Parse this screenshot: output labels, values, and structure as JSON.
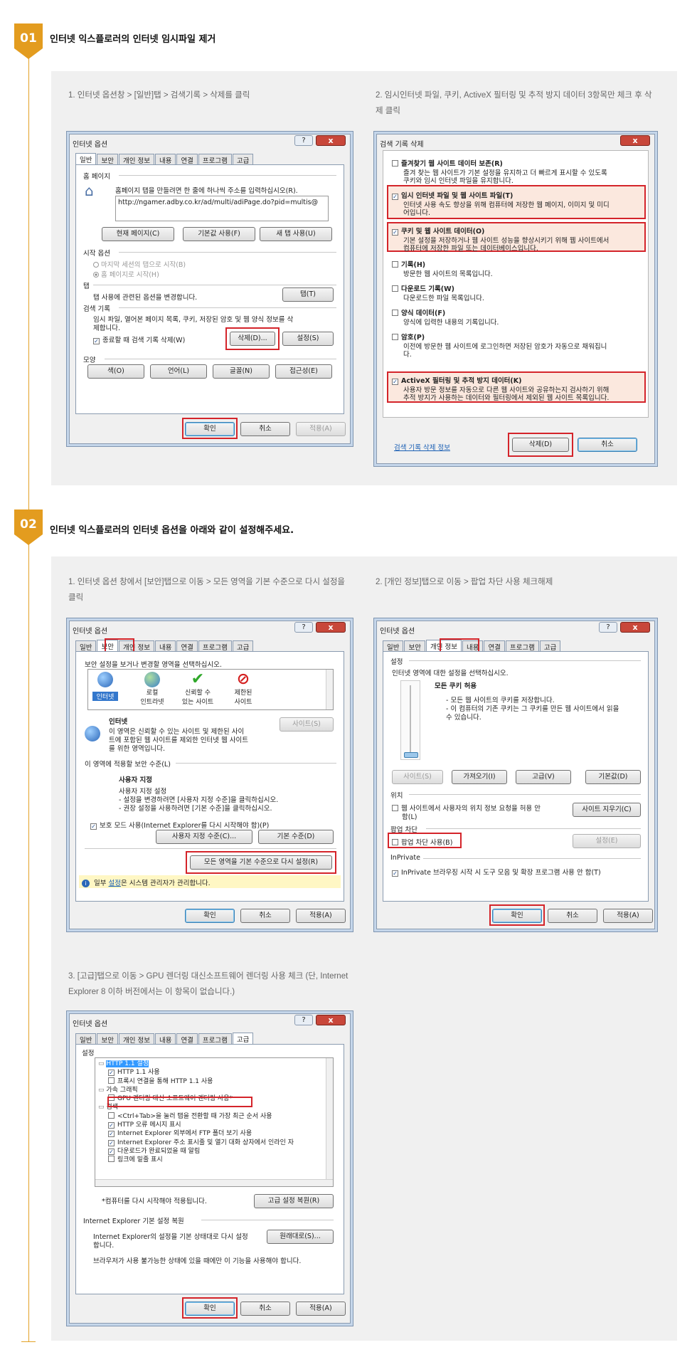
{
  "steps": [
    {
      "num": "01",
      "title": "인터넷 익스플로러의 인터넷 임시파일 제거",
      "cap1": "1. 인터넷 옵션창 > [일반]탭 > 검색기록 > 삭제를 클릭",
      "cap2a": "2. 임시인터넷 파일, 쿠키, ActiveX 필터링 및 추적 방지 데이터 3항목만 체크 후 삭",
      "cap2b": "제 클릭"
    },
    {
      "num": "02",
      "title": "인터넷 익스플로러의 인터넷 옵션을 아래와 같이 설정해주세요.",
      "cap1a": "1. 인터넷 옵션 창에서 [보안]탭으로 이동 > 모든 영역을 기본 수준으로 다시 설정을",
      "cap1b": "클릭",
      "cap2": "2. [개인 정보]탭으로 이동 > 팝업 차단 사용 체크해제",
      "cap3a": "3. [고급]탭으로 이동 > GPU 렌더링 대신소프트웨어 렌더링 사용 체크 (단, Internet",
      "cap3b": "Explorer 8 이하 버전에서는 이 항목이 없습니다.)"
    }
  ],
  "common": {
    "win_title": "인터넷 옵션",
    "help": "?",
    "close": "x",
    "ok": "확인",
    "cancel": "취소",
    "apply": "적용(A)",
    "tabs": [
      "일반",
      "보안",
      "개인 정보",
      "내용",
      "연결",
      "프로그램",
      "고급"
    ]
  },
  "general": {
    "home": "홈 페이지",
    "home_desc": "홈페이지 탭을 만들려면 한 줄에 하나씩 주소를 입력하십시오(R).",
    "url": "http://ngamer.adby.co.kr/ad/multi/adiPage.do?pid=multis@",
    "btn_current": "현재 페이지(C)",
    "btn_default": "기본값 사용(F)",
    "btn_newtab": "새 탭 사용(U)",
    "startup": "시작 옵션",
    "startup1": "마지막 세션의 탭으로 시작(B)",
    "startup2": "홈 페이지로 시작(H)",
    "tabs_h": "탭",
    "tabs_desc": "탭 사용에 관련된 옵션을 변경합니다.",
    "tabs_btn": "탭(T)",
    "history": "검색 기록",
    "history_desc1": "임시 파일, 열어본 페이지 목록, 쿠키, 저장된 암호 및 웹 양식 정보를 삭",
    "history_desc2": "제합니다.",
    "history_chk": "종료할 때 검색 기록 삭제(W)",
    "delete_btn": "삭제(D)...",
    "settings_btn": "설정(S)",
    "appearance": "모양",
    "btn_color": "색(O)",
    "btn_lang": "언어(L)",
    "btn_font": "글꼴(N)",
    "btn_access": "접근성(E)"
  },
  "delete_dialog": {
    "title": "검색 기록 삭제",
    "items": [
      {
        "label": "즐겨찾기 웹 사이트 데이터 보존(R)",
        "d1": "즐겨 찾는 웹 사이트가 기본 설정을 유지하고 더 빠르게 표시할 수 있도록",
        "d2": "쿠키와 임시 인터넷 파일을 유지합니다.",
        "checked": ""
      },
      {
        "label": "임시 인터넷 파일 및 웹 사이트 파일(T)",
        "d1": "인터넷 사용 속도 향상을 위해 컴퓨터에 저장한 웹 페이지, 이미지 및 미디",
        "d2": "어입니다.",
        "checked": "✓"
      },
      {
        "label": "쿠키 및 웹 사이트 데이터(O)",
        "d1": "기본 설정을 저장하거나 웹 사이트 성능을 향상시키기 위해 웹 사이트에서",
        "d2": "컴퓨터에 저장한 파일 또는 데이터베이스입니다.",
        "checked": "✓"
      },
      {
        "label": "기록(H)",
        "d1": "방문한 웹 사이트의 목록입니다.",
        "d2": "",
        "checked": ""
      },
      {
        "label": "다운로드 기록(W)",
        "d1": "다운로드한 파일 목록입니다.",
        "d2": "",
        "checked": ""
      },
      {
        "label": "양식 데이터(F)",
        "d1": "양식에 입력한 내용의 기록입니다.",
        "d2": "",
        "checked": ""
      },
      {
        "label": "암호(P)",
        "d1": "이전에 방문한 웹 사이트에 로그인하면 저장된 암호가 자동으로 채워집니",
        "d2": "다.",
        "checked": ""
      },
      {
        "label": "ActiveX 필터링 및 추적 방지 데이터(K)",
        "d1": "사용자 방문 정보를 자동으로 다른 웹 사이트와 공유하는지 검사하기 위해",
        "d2": "추적 방지가 사용하는 데이터와 필터링에서 제외된 웹 사이트 목록입니다.",
        "checked": "✓"
      }
    ],
    "link": "검색 기록 삭제 정보",
    "delete": "삭제(D)",
    "cancel": "취소"
  },
  "security": {
    "desc": "보안 설정을 보거나 변경할 영역을 선택하십시오.",
    "zones": [
      "인터넷",
      "로컬",
      "인트라넷",
      "신뢰할 수",
      "있는 사이트",
      "제한된",
      "사이트"
    ],
    "zone_name": "인터넷",
    "sites_btn": "사이트(S)",
    "zone_desc1": "이 영역은 신뢰할 수 있는 사이트 및 제한된 사이",
    "zone_desc2": "트에 포함된 웹 사이트를 제외한 인터넷 웹 사이트",
    "zone_desc3": "를 위한 영역입니다.",
    "level_h": "이 영역에 적용할 보안 수준(L)",
    "custom": "사용자 지정",
    "custom1": "사용자 지정 설정",
    "custom2": "- 설정을 변경하려면 [사용자 지정 수준]을 클릭하십시오.",
    "custom3": "- 권장 설정을 사용하려면 [기본 수준]을 클릭하십시오.",
    "protect": "보호 모드 사용(Internet Explorer를 다시 시작해야 함)(P)",
    "custom_btn": "사용자 지정 수준(C)...",
    "default_btn": "기본 수준(D)",
    "reset_all": "모든 영역을 기본 수준으로 다시 설정(R)",
    "info_a": "일부 ",
    "info_link": "설정",
    "info_b": "은 시스템 관리자가 관리합니다."
  },
  "privacy": {
    "settings": "설정",
    "desc": "인터넷 영역에 대한 설정을 선택하십시오.",
    "level": "모든 쿠키 허용",
    "d1": "- 모든 웹 사이트의 쿠키를 저장합니다.",
    "d2": "- 이 컴퓨터의 기존 쿠키는 그 쿠키를 만든 웹 사이트에서 읽을",
    "d3": "수 있습니다.",
    "b_sites": "사이트(S)",
    "b_import": "가져오기(I)",
    "b_adv": "고급(V)",
    "b_default": "기본값(D)",
    "location": "위치",
    "loc_chk1": "웹 사이트에서 사용자의 위치 정보 요청을 허용 안",
    "loc_chk2": "함(L)",
    "clear_sites": "사이트 지우기(C)",
    "popup": "팝업 차단",
    "popup_chk": "팝업 차단 사용(B)",
    "popup_settings": "설정(E)",
    "inprivate": "InPrivate",
    "inprivate_chk": "InPrivate 브라우징 시작 시 도구 모음 및 확장 프로그램 사용 안 함(T)"
  },
  "advanced": {
    "settings": "설정",
    "tree": [
      "HTTP 1.1 설정",
      "HTTP 1.1 사용",
      "프록시 연결을 통해 HTTP 1.1 사용",
      "가속 그래픽",
      "GPU 렌더링 대신 소프트웨어 렌더링 사용*",
      "검색",
      "<Ctrl+Tab>을 눌러 탭을 전환할 때 가장 최근 순서 사용",
      "HTTP 오류 메시지 표시",
      "Internet Explorer 외부에서 FTP 폴더 보기 사용",
      "Internet Explorer 주소 표시줄 및 열기 대화 상자에서 인라인 자",
      "다운로드가 완료되었을 때 알림",
      "링크에 밑줄 표시"
    ],
    "restart_note": "*컴퓨터를 다시 시작해야 적용됩니다.",
    "restore_adv": "고급 설정 복원(R)",
    "reset_h": "Internet Explorer 기본 설정 복원",
    "reset_d1": "Internet Explorer의 설정을 기본 상태대로 다시 설정",
    "reset_d2": "합니다.",
    "reset_btn": "원래대로(S)...",
    "reset_note": "브라우저가 사용 불가능한 상태에 있을 때에만 이 기능을 사용해야 합니다."
  }
}
